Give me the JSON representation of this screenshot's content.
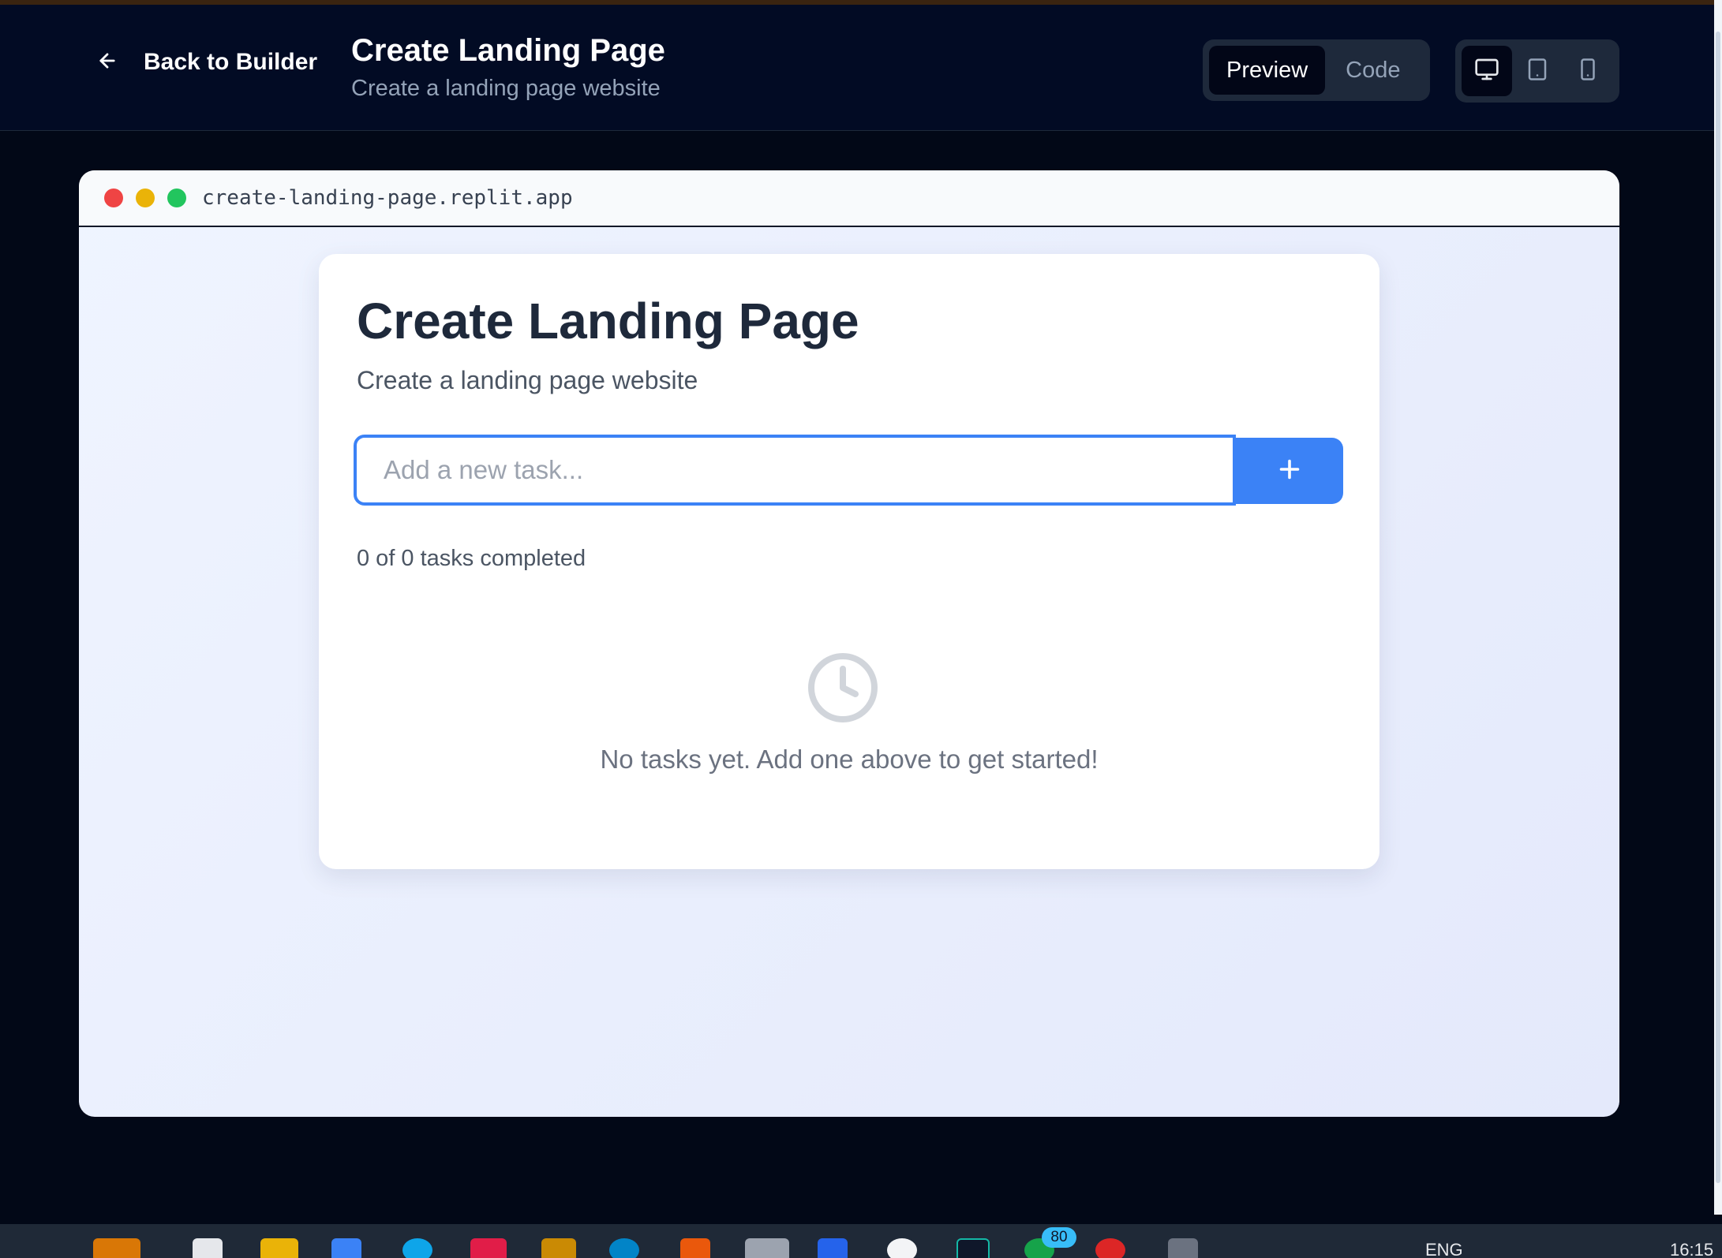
{
  "header": {
    "back_label": "Back to Builder",
    "title": "Create Landing Page",
    "subtitle": "Create a landing page website",
    "modes": {
      "preview": "Preview",
      "code": "Code",
      "active": "preview"
    },
    "devices": [
      {
        "icon": "desktop-icon",
        "active": true
      },
      {
        "icon": "tablet-icon",
        "active": false
      },
      {
        "icon": "mobile-icon",
        "active": false
      }
    ]
  },
  "browser": {
    "url": "create-landing-page.replit.app",
    "dot_colors": [
      "#ef4444",
      "#eab308",
      "#22c55e"
    ]
  },
  "app": {
    "title": "Create Landing Page",
    "subtitle": "Create a landing page website",
    "input_placeholder": "Add a new task...",
    "input_value": "",
    "add_icon": "plus-icon",
    "progress_text": "0 of 0 tasks completed",
    "empty_icon": "clock-icon",
    "empty_text": "No tasks yet. Add one above to get started!"
  },
  "taskbar": {
    "badge": "80",
    "language": "ENG",
    "time": "16:15"
  },
  "colors": {
    "accent": "#3b82f6",
    "header_bg": "#020b24",
    "page_bg": "#020817"
  }
}
